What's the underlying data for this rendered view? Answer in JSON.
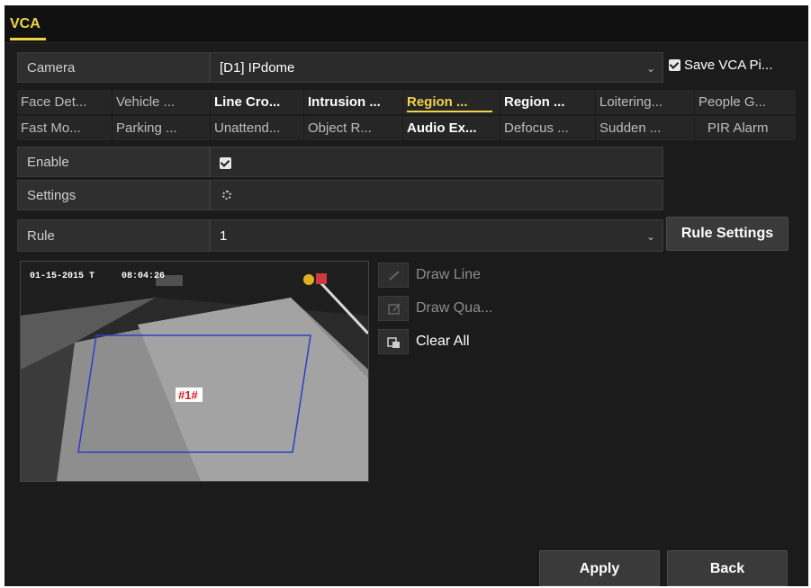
{
  "title": {
    "tab": "VCA"
  },
  "camera": {
    "label": "Camera",
    "value": "[D1] IPdome"
  },
  "save_vca": {
    "label": "Save VCA Pi...",
    "checked": true
  },
  "tabs_row1": [
    {
      "label": "Face Det..."
    },
    {
      "label": "Vehicle ..."
    },
    {
      "label": "Line Cro..."
    },
    {
      "label": "Intrusion ..."
    },
    {
      "label": "Region ..."
    },
    {
      "label": "Region ..."
    },
    {
      "label": "Loitering..."
    },
    {
      "label": "People G..."
    }
  ],
  "tabs_row2": [
    {
      "label": "Fast Mo..."
    },
    {
      "label": "Parking ..."
    },
    {
      "label": "Unattend..."
    },
    {
      "label": "Object R..."
    },
    {
      "label": "Audio Ex..."
    },
    {
      "label": "Defocus ..."
    },
    {
      "label": "Sudden ..."
    },
    {
      "label": "PIR Alarm"
    }
  ],
  "enable": {
    "label": "Enable",
    "checked": true
  },
  "settings": {
    "label": "Settings"
  },
  "rule": {
    "label": "Rule",
    "value": "1",
    "settings_button": "Rule Settings"
  },
  "video": {
    "timestamp": "01-15-2015 T",
    "time": "08:04:26",
    "region_label": "#1#"
  },
  "tools": {
    "draw_line": "Draw Line",
    "draw_quad": "Draw Qua...",
    "clear_all": "Clear All"
  },
  "footer": {
    "apply": "Apply",
    "back": "Back"
  },
  "colors": {
    "accent": "#f0d34a",
    "region": "#2c3ec8"
  }
}
